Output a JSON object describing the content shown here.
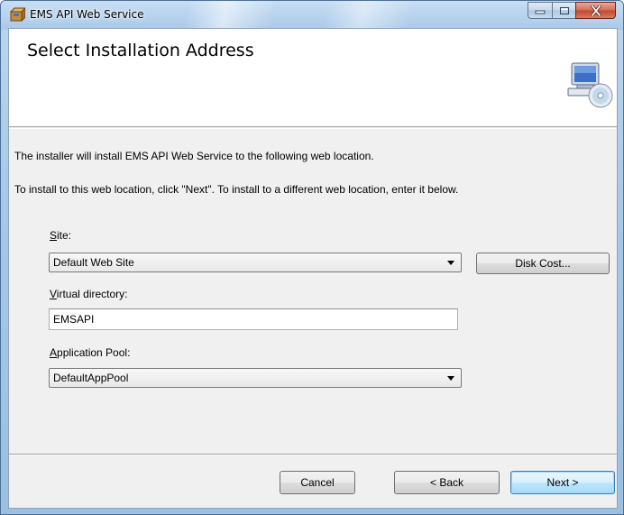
{
  "window": {
    "title": "EMS API Web Service"
  },
  "banner": {
    "title": "Select Installation Address"
  },
  "body": {
    "line1": "The installer will install EMS API Web Service to the following web location.",
    "line2": "To install to this web location, click \"Next\". To install to a different web location, enter it below."
  },
  "site": {
    "label_mnemonic": "S",
    "label_rest": "ite:",
    "value": "Default Web Site",
    "disk_cost_label": "Disk Cost..."
  },
  "vdir": {
    "label_mnemonic": "V",
    "label_rest": "irtual directory:",
    "value": "EMSAPI"
  },
  "pool": {
    "label_mnemonic": "A",
    "label_rest": "pplication Pool:",
    "value": "DefaultAppPool"
  },
  "footer": {
    "cancel_label": "Cancel",
    "back_label": "< Back",
    "next_label": "Next >"
  },
  "colors": {
    "accent": "#3c7fb1",
    "close_button": "#c24a30"
  },
  "icons": {
    "app": "installer-box-icon",
    "banner": "computer-cd-icon",
    "dropdown": "chevron-down-icon"
  }
}
